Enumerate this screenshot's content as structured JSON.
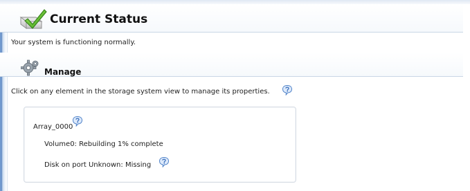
{
  "status": {
    "title": "Current Status",
    "message": "Your system is functioning normally."
  },
  "manage": {
    "title": "Manage",
    "instruction": "Click on any element in the storage system view to manage its properties."
  },
  "storage": {
    "array_name": "Array_0000",
    "volume_status": "Volume0:  Rebuilding 1% complete",
    "disk_status": "Disk on port Unknown:  Missing"
  },
  "icons": {
    "status": "checkmark-status-icon",
    "manage": "gear-icon",
    "help": "help-balloon-icon"
  },
  "colors": {
    "accent_green": "#5fbf2a",
    "help_blue": "#5b8fd8",
    "divider": "#c9d6e6"
  }
}
